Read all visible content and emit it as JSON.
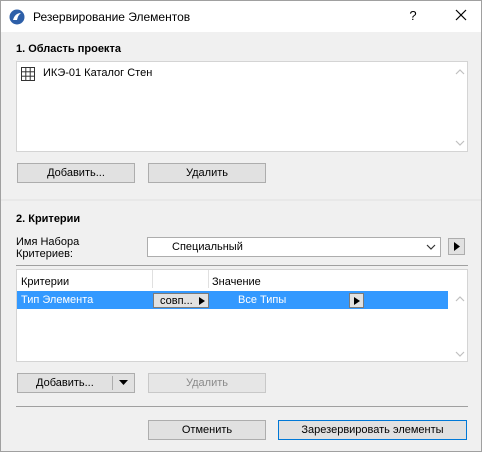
{
  "window": {
    "title": "Резервирование Элементов",
    "help_label": "?"
  },
  "section1": {
    "title": "1. Область проекта",
    "items": [
      {
        "icon": "table-grid-icon",
        "label": "ИКЭ-01 Каталог Стен"
      }
    ],
    "add_label": "Добавить...",
    "remove_label": "Удалить"
  },
  "section2": {
    "title": "2. Критерии",
    "set_name_label_line1": "Имя Набора",
    "set_name_label_line2": "Критериев:",
    "set_name_value": "Специальный",
    "columns": [
      "Критерии",
      "",
      "Значение"
    ],
    "rows": [
      {
        "criterion": "Тип Элемента",
        "operator": "совп...",
        "value": "Все Типы"
      }
    ],
    "add_label": "Добавить...",
    "remove_label": "Удалить"
  },
  "footer": {
    "cancel_label": "Отменить",
    "reserve_label": "Зарезервировать элементы"
  },
  "colors": {
    "selection": "#3399ff",
    "background": "#f0f0f0",
    "list_background": "#ffffff"
  }
}
